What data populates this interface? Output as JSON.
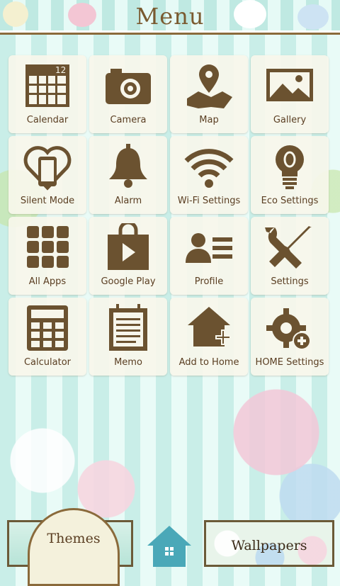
{
  "header": {
    "title": "Menu"
  },
  "tiles": [
    {
      "label": "Calendar",
      "icon": "calendar-icon",
      "badge": "12"
    },
    {
      "label": "Camera",
      "icon": "camera-icon"
    },
    {
      "label": "Map",
      "icon": "map-icon"
    },
    {
      "label": "Gallery",
      "icon": "gallery-icon"
    },
    {
      "label": "Silent Mode",
      "icon": "silent-mode-icon"
    },
    {
      "label": "Alarm",
      "icon": "bell-icon"
    },
    {
      "label": "Wi-Fi Settings",
      "icon": "wifi-icon"
    },
    {
      "label": "Eco Settings",
      "icon": "lightbulb-icon"
    },
    {
      "label": "All Apps",
      "icon": "apps-grid-icon"
    },
    {
      "label": "Google Play",
      "icon": "play-store-icon"
    },
    {
      "label": "Profile",
      "icon": "profile-card-icon"
    },
    {
      "label": "Settings",
      "icon": "tools-icon"
    },
    {
      "label": "Calculator",
      "icon": "calculator-icon"
    },
    {
      "label": "Memo",
      "icon": "notepad-icon"
    },
    {
      "label": "Add to Home",
      "icon": "add-home-icon"
    },
    {
      "label": "HOME Settings",
      "icon": "gear-plus-icon"
    }
  ],
  "dock": {
    "themes_label": "Themes",
    "wallpapers_label": "Wallpapers",
    "home_icon": "home-apps-icon"
  },
  "colors": {
    "icon_brown": "#6b5230",
    "text_brown": "#5a3e22",
    "tile_bg": "#f7f6eb",
    "stripe_mint": "#c9eee8",
    "stripe_light": "#e9fbf7",
    "home_button": "#4aa8b8"
  }
}
